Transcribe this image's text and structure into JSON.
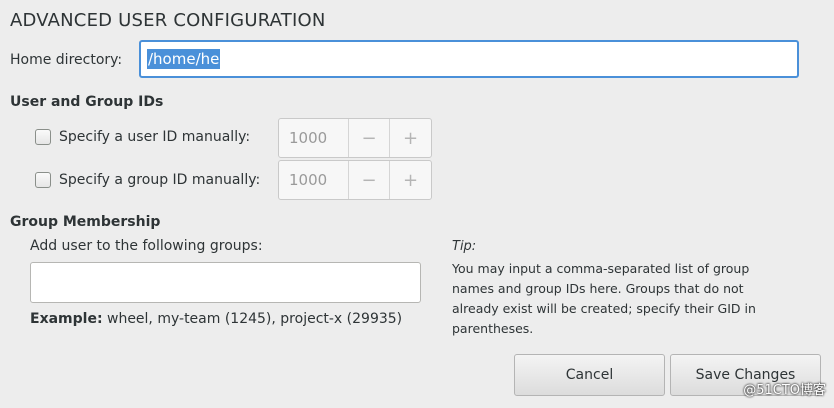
{
  "dialog": {
    "title": "ADVANCED USER CONFIGURATION"
  },
  "home": {
    "label": "Home directory:",
    "value": "/home/he"
  },
  "ids": {
    "section_title": "User and Group IDs",
    "user": {
      "label": "Specify a user ID manually:",
      "value": "1000",
      "checked": false
    },
    "group": {
      "label": "Specify a group ID manually:",
      "value": "1000",
      "checked": false
    },
    "minus": "−",
    "plus": "+"
  },
  "membership": {
    "section_title": "Group Membership",
    "groups_label": "Add user to the following groups:",
    "groups_value": "",
    "example_label": "Example:",
    "example_value": " wheel, my-team (1245), project-x (29935)",
    "tip_title": "Tip:",
    "tip_text": "You may input a comma-separated list of group names and group IDs here. Groups that do not already exist will be created; specify their GID in parentheses."
  },
  "buttons": {
    "cancel": "Cancel",
    "save": "Save Changes"
  },
  "watermark": "@51CTO博客",
  "colors": {
    "accent": "#4a90d9",
    "background": "#ededed"
  }
}
